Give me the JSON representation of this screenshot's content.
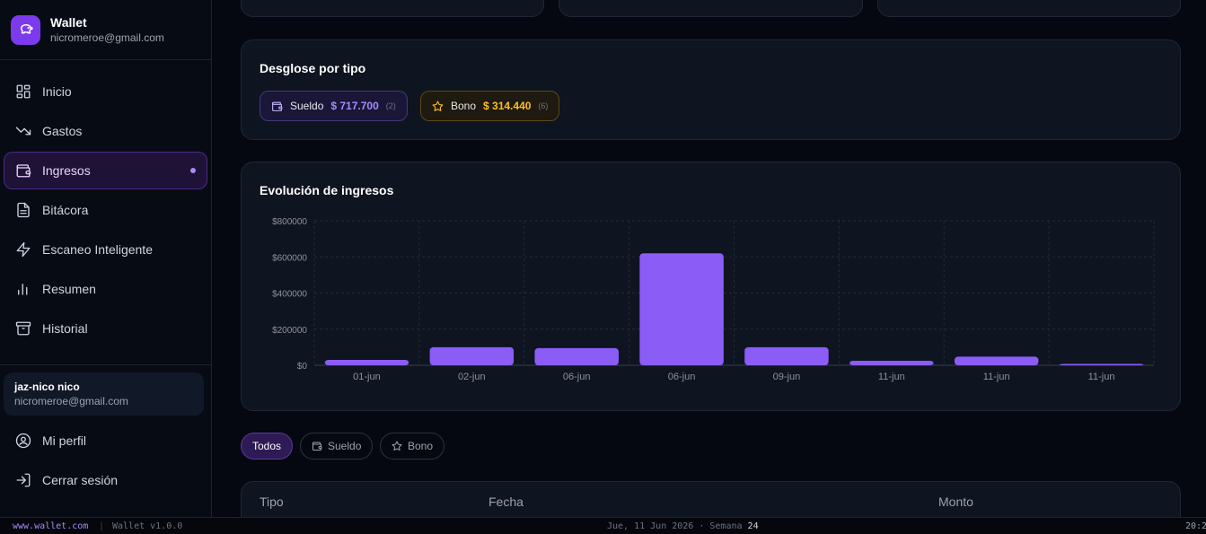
{
  "brand": {
    "title": "Wallet",
    "email": "nicromeroe@gmail.com"
  },
  "nav": [
    {
      "label": "Inicio",
      "icon": "dashboard-icon"
    },
    {
      "label": "Gastos",
      "icon": "trending-down-icon"
    },
    {
      "label": "Ingresos",
      "icon": "wallet-icon",
      "active": true
    },
    {
      "label": "Bitácora",
      "icon": "document-icon"
    },
    {
      "label": "Escaneo Inteligente",
      "icon": "lightning-icon"
    },
    {
      "label": "Resumen",
      "icon": "bar-chart-icon"
    },
    {
      "label": "Historial",
      "icon": "archive-icon"
    }
  ],
  "user": {
    "name": "jaz-nico nico",
    "email": "nicromeroe@gmail.com"
  },
  "bottom_nav": [
    {
      "label": "Mi perfil",
      "icon": "user-circle-icon"
    },
    {
      "label": "Cerrar sesión",
      "icon": "logout-icon"
    }
  ],
  "breakdown": {
    "title": "Desglose por tipo",
    "items": [
      {
        "label": "Sueldo",
        "amount": "$ 717.700",
        "count": "(2)",
        "color": "#a78bfa"
      },
      {
        "label": "Bono",
        "amount": "$ 314.440",
        "count": "(6)",
        "color": "#fbbf24"
      }
    ]
  },
  "chart_card": {
    "title": "Evolución de ingresos"
  },
  "chart_data": {
    "type": "bar",
    "title": "Evolución de ingresos",
    "categories": [
      "01-jun",
      "02-jun",
      "06-jun",
      "06-jun",
      "09-jun",
      "11-jun",
      "11-jun",
      "11-jun"
    ],
    "values": [
      30000,
      100000,
      95000,
      620000,
      100000,
      25000,
      48000,
      5000
    ],
    "ylim": [
      0,
      800000
    ],
    "yticks": [
      0,
      200000,
      400000,
      600000,
      800000
    ],
    "ytick_labels": [
      "$0",
      "$200000",
      "$400000",
      "$600000",
      "$800000"
    ],
    "grid": true,
    "bar_color": "#8b5cf6"
  },
  "filters": [
    {
      "label": "Todos",
      "active": true
    },
    {
      "label": "Sueldo",
      "icon": "wallet-icon"
    },
    {
      "label": "Bono",
      "icon": "star-icon"
    }
  ],
  "table": {
    "headers": [
      "Tipo",
      "Fecha",
      "Monto"
    ]
  },
  "statusbar": {
    "url": "www.wallet.com",
    "sep": "|",
    "version": "Wallet v1.0.0",
    "date": "Jue, 11 Jun 2026 · Semana",
    "week": "24",
    "time": "20:2"
  }
}
